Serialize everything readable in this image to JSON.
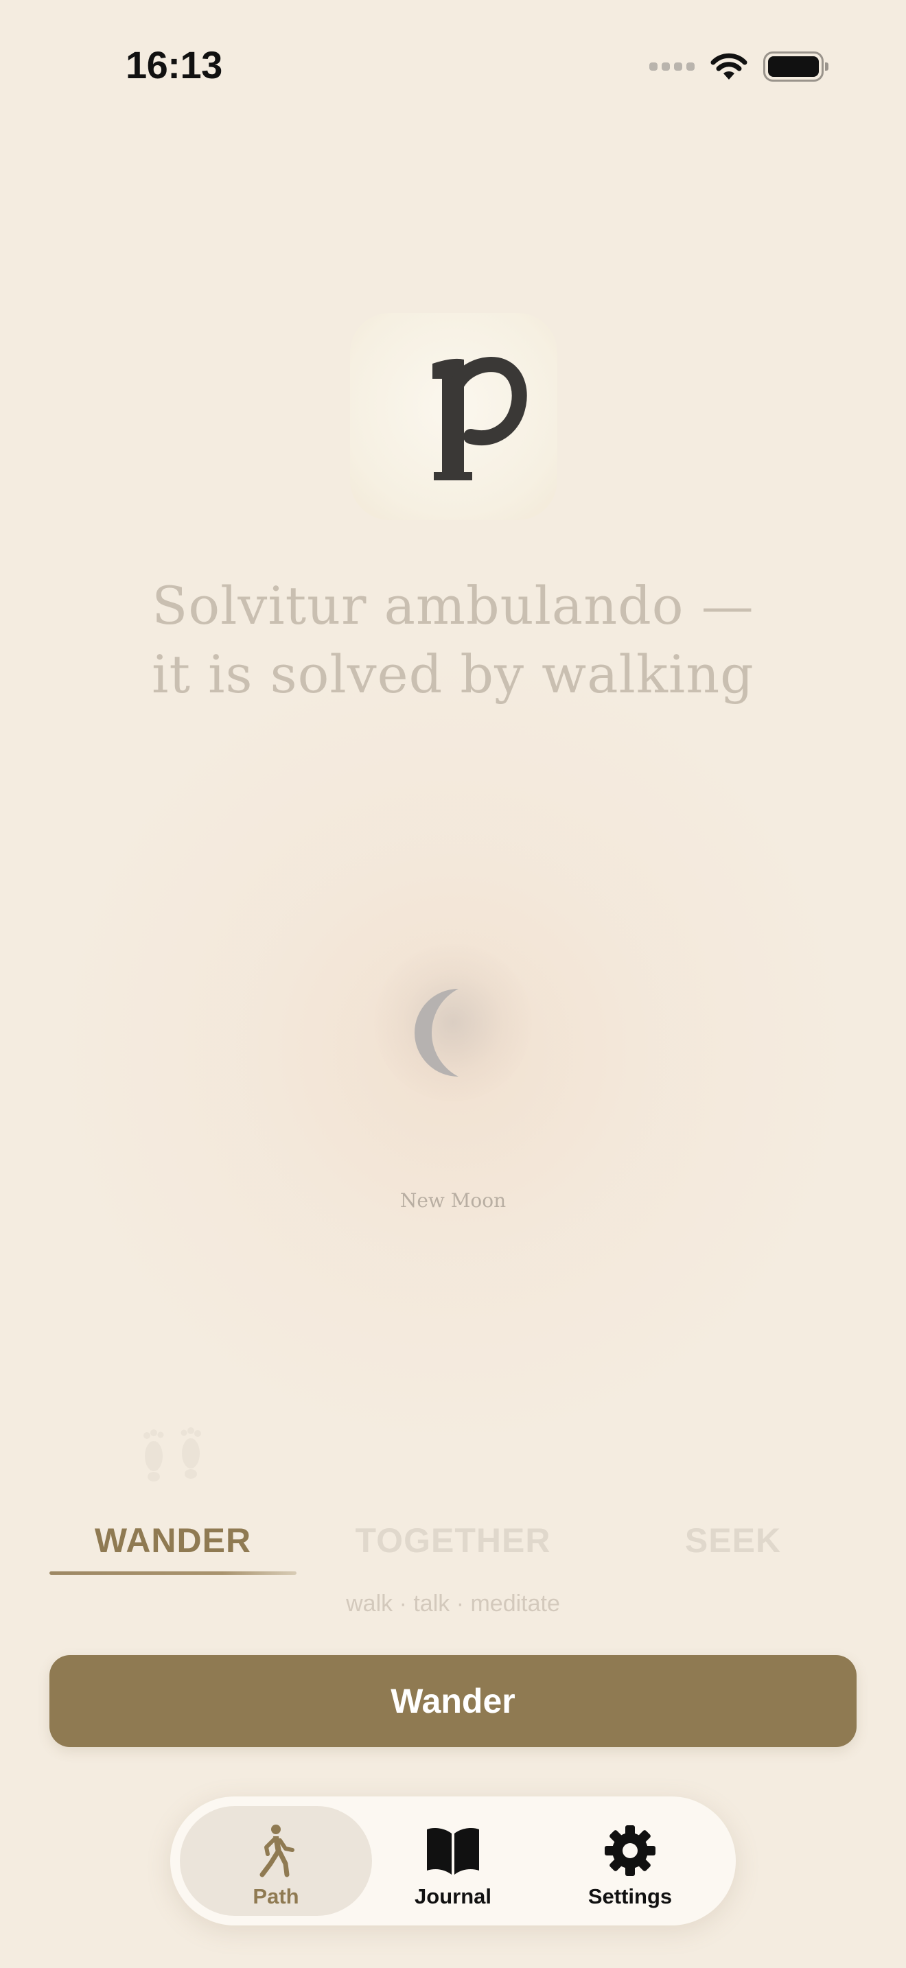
{
  "status_bar": {
    "time": "16:13",
    "signal_icon": "cellular-signal-icon",
    "wifi_icon": "wifi-icon",
    "battery_icon": "battery-icon"
  },
  "logo": {
    "letter": "p",
    "icon": "app-logo-icon"
  },
  "tagline": {
    "line1": "Solvitur ambulando —",
    "line2": "it is solved by walking"
  },
  "moon": {
    "phase_label": "New Moon",
    "icon": "crescent-moon-icon"
  },
  "footprints_icon": "footprints-icon",
  "modes": {
    "items": [
      {
        "label": "WANDER",
        "selected": true
      },
      {
        "label": "TOGETHER",
        "selected": false
      },
      {
        "label": "SEEK",
        "selected": false
      }
    ],
    "subtitle": "walk · talk · meditate"
  },
  "primary_button": {
    "label": "Wander"
  },
  "tab_bar": {
    "items": [
      {
        "label": "Path",
        "icon": "walking-person-icon",
        "active": true
      },
      {
        "label": "Journal",
        "icon": "open-book-icon",
        "active": false
      },
      {
        "label": "Settings",
        "icon": "gear-icon",
        "active": false
      }
    ]
  },
  "colors": {
    "background": "#f4ece0",
    "accent": "#8f7a52",
    "inactive_text": "#e0d8cc",
    "tagline_text": "#c9bfb1"
  }
}
